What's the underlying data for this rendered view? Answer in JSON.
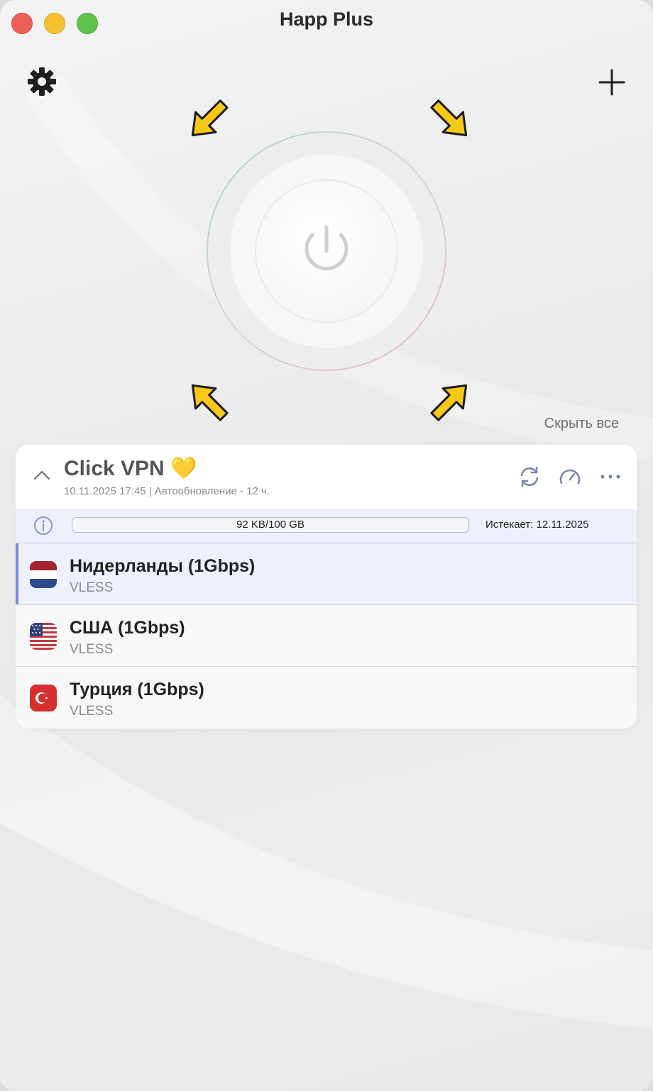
{
  "window": {
    "title": "Happ Plus"
  },
  "toolbar": {
    "settings_icon": "gear-icon",
    "add_icon": "plus-icon"
  },
  "connect": {
    "power_icon": "power-icon",
    "hint_icon": "arrow-icon"
  },
  "list": {
    "hide_all_label": "Скрыть все"
  },
  "subscription": {
    "name": "Click VPN 💛",
    "meta": "10.11.2025 17:45 | Автообновление - 12 ч.",
    "usage_text": "92 KB/100 GB",
    "usage_fraction": 0.0,
    "expires": "Истекает: 12.11.2025",
    "icons": [
      "chevron-up-icon",
      "refresh-icon",
      "speedometer-icon",
      "more-icon",
      "info-icon"
    ]
  },
  "servers": [
    {
      "name": "Нидерланды (1Gbps)",
      "protocol": "VLESS",
      "flag": "netherlands-flag",
      "selected": true
    },
    {
      "name": "США (1Gbps)",
      "protocol": "VLESS",
      "flag": "usa-flag",
      "selected": false
    },
    {
      "name": "Турция (1Gbps)",
      "protocol": "VLESS",
      "flag": "turkey-flag",
      "selected": false
    }
  ],
  "colors": {
    "accent": "#7a8ce0",
    "arrow": "#f6c716",
    "close": "#ee5f57",
    "minimize": "#f5c12f",
    "maximize": "#5ec44e"
  }
}
